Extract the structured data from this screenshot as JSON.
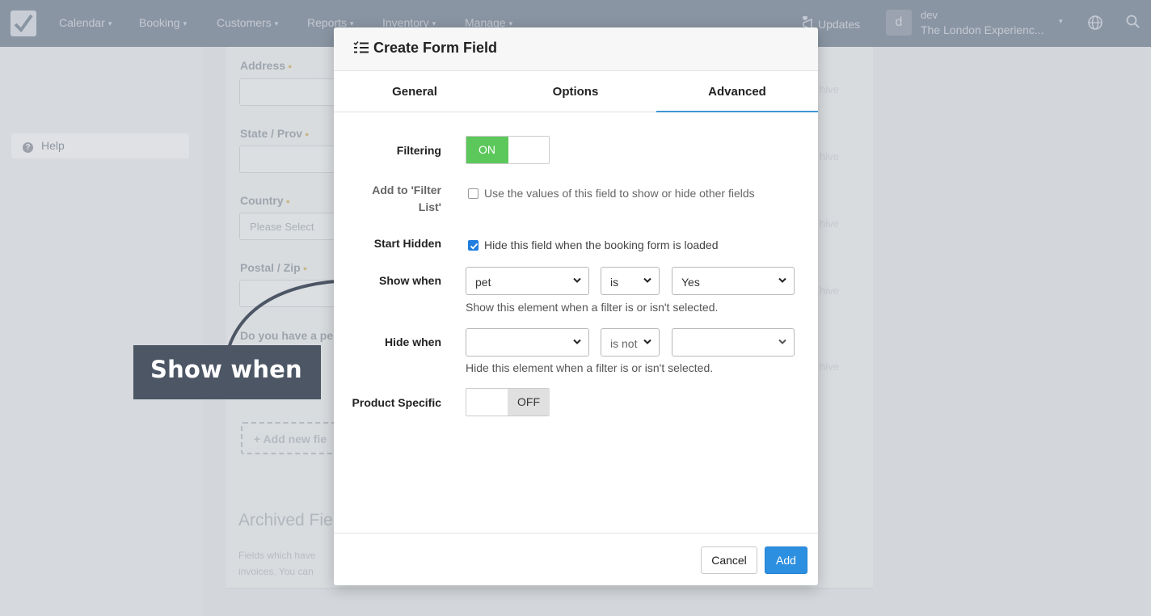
{
  "nav": {
    "items": [
      {
        "label": "Calendar"
      },
      {
        "label": "Booking"
      },
      {
        "label": "Customers"
      },
      {
        "label": "Reports"
      },
      {
        "label": "Inventory"
      },
      {
        "label": "Manage"
      }
    ],
    "updates_label": "Updates",
    "user": {
      "initial": "d",
      "name": "dev",
      "org": "The London Experienc..."
    }
  },
  "sidebar": {
    "help_label": "Help"
  },
  "background": {
    "fields": [
      {
        "label": "Address"
      },
      {
        "label": "State / Prov"
      },
      {
        "label": "Country",
        "placeholder": "Please Select"
      },
      {
        "label": "Postal / Zip"
      },
      {
        "label": "Do you have a pe"
      }
    ],
    "archive_label": "hive",
    "add_field_label": "+ Add new fie",
    "archived_title": "Archived Fie",
    "archived_desc_line1": "Fields which have",
    "archived_desc_line2": "invoices. You can"
  },
  "annotation": {
    "label": "Show when",
    "color": "#4c5665"
  },
  "modal": {
    "title": "Create Form Field",
    "tabs": [
      {
        "label": "General",
        "active": false
      },
      {
        "label": "Options",
        "active": false
      },
      {
        "label": "Advanced",
        "active": true
      }
    ],
    "filtering": {
      "label": "Filtering",
      "state": "ON"
    },
    "filter_list": {
      "label_line1": "Add to 'Filter",
      "label_line2": "List'",
      "checkbox_label": "Use the values of this field to show or hide other fields",
      "checked": false
    },
    "start_hidden": {
      "label": "Start Hidden",
      "checkbox_label": "Hide this field when the booking form is loaded",
      "checked": true
    },
    "show_when": {
      "label": "Show when",
      "field": "pet",
      "operator": "is",
      "value": "Yes",
      "help": "Show this element when a filter is or isn't selected."
    },
    "hide_when": {
      "label": "Hide when",
      "field": "",
      "operator": "is not",
      "value": "",
      "help": "Hide this element when a filter is or isn't selected."
    },
    "product_specific": {
      "label": "Product Specific",
      "state": "OFF"
    },
    "cancel_label": "Cancel",
    "add_label": "Add"
  },
  "colors": {
    "accent": "#3d97d6",
    "toggle_on": "#5cc85c",
    "primary_button": "#2d8fe0"
  }
}
